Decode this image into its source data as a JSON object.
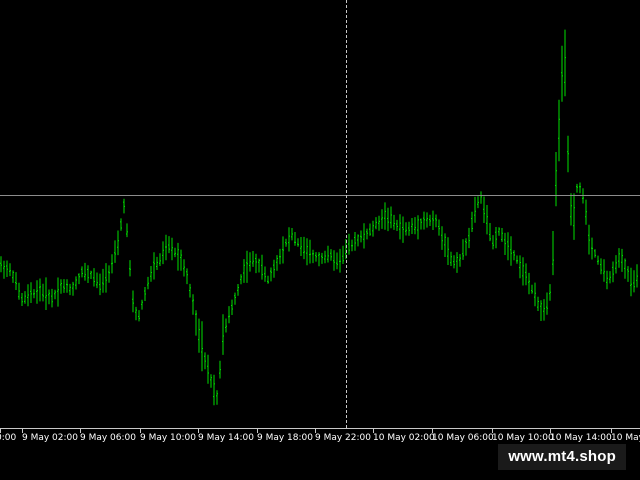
{
  "chart": {
    "background": "#000000",
    "bar_color": "#00e000",
    "grid_color": "#c8c8c8",
    "crosshair": true,
    "x_axis_labels": [
      "0:00",
      "9 May 02:00",
      "9 May 06:00",
      "9 May 10:00",
      "9 May 14:00",
      "9 May 18:00",
      "9 May 22:00",
      "10 May 02:00",
      "10 May 06:00",
      "10 May 10:00",
      "10 May 14:00",
      "10 May"
    ]
  },
  "watermark": {
    "text": "www.mt4.shop"
  }
}
